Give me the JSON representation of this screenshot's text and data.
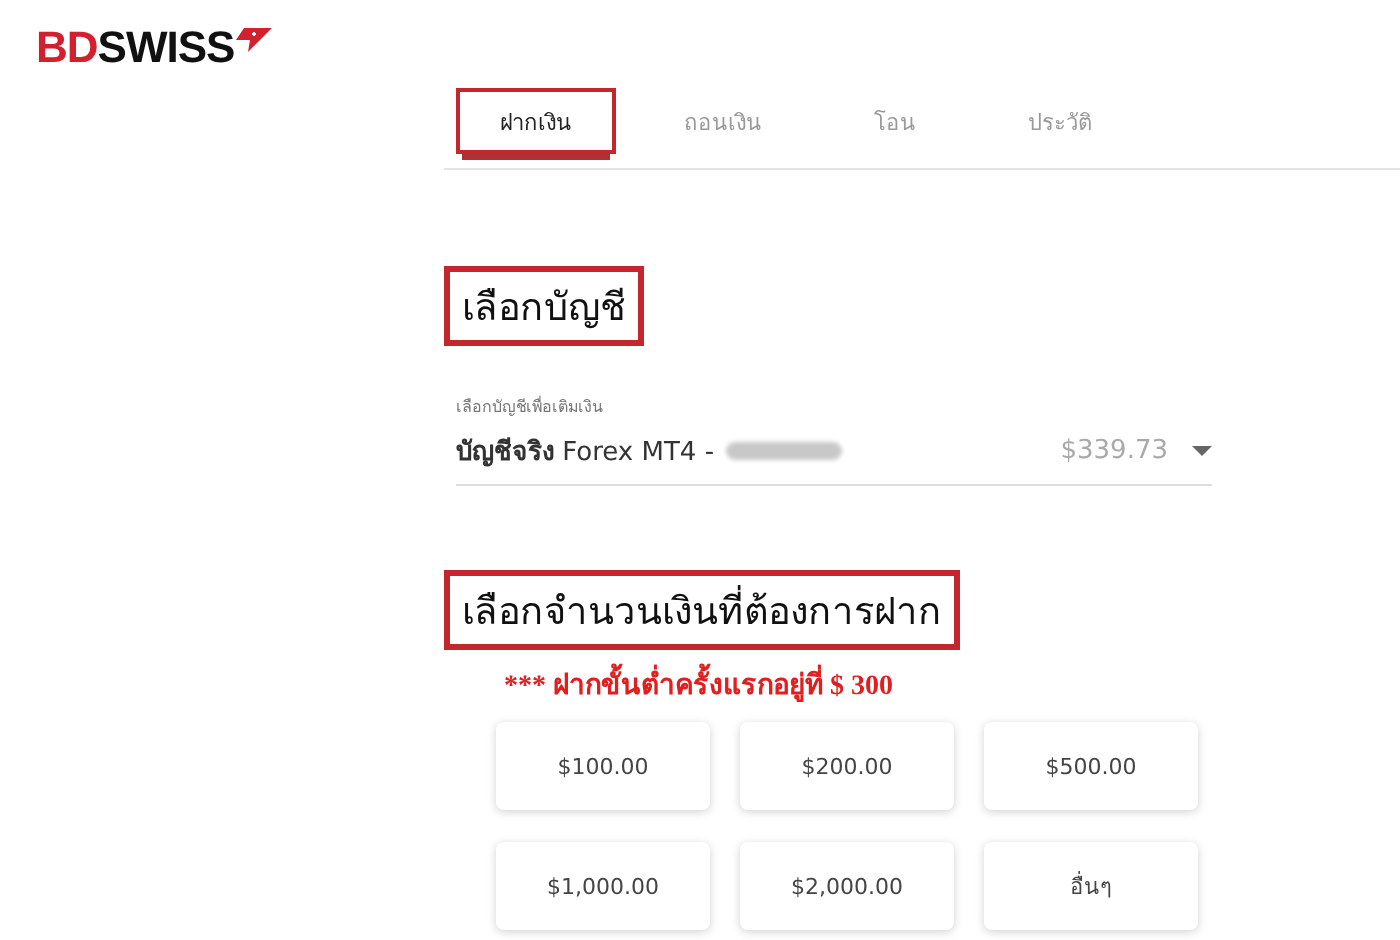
{
  "logo": {
    "accent": "BD",
    "rest": "SWISS"
  },
  "tabs": [
    {
      "label": "ฝากเงิน",
      "selected": true,
      "highlighted": true
    },
    {
      "label": "ถอนเงิน",
      "selected": false,
      "highlighted": false
    },
    {
      "label": "โอน",
      "selected": false,
      "highlighted": false
    },
    {
      "label": "ประวัติ",
      "selected": false,
      "highlighted": false
    }
  ],
  "account_section": {
    "heading": "เลือกบัญชี",
    "highlighted": true,
    "field": {
      "label": "เลือกบัญชีเพื่อเติมเงิน",
      "value_bold": "บัญชีจริง",
      "value": "Forex MT4 -",
      "redacted": true,
      "balance": "$339.73"
    }
  },
  "amount_section": {
    "heading": "เลือกจำนวนเงินที่ต้องการฝาก",
    "highlighted": true,
    "note": "*** ฝากขั้นต่ำครั้งแรกอยู่ที่ $ 300",
    "options": [
      "$100.00",
      "$200.00",
      "$500.00",
      "$1,000.00",
      "$2,000.00",
      "อื่นๆ"
    ]
  }
}
